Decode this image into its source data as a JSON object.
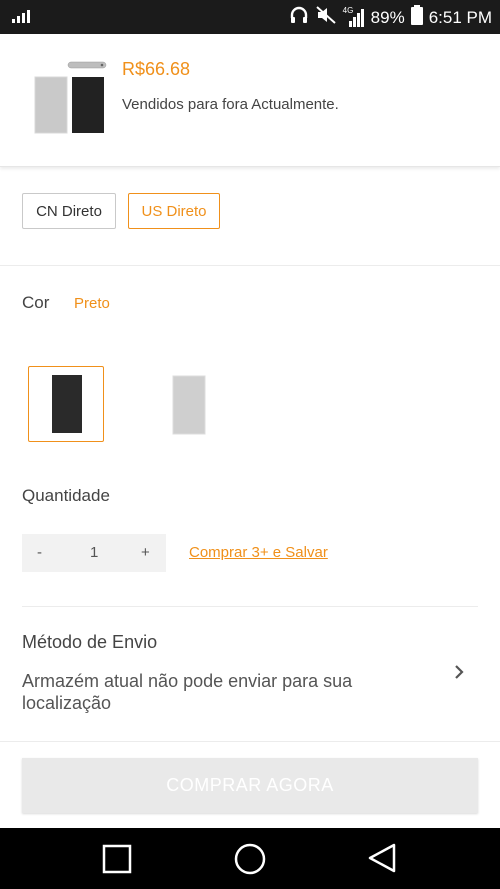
{
  "status_bar": {
    "network": "4G",
    "battery": "89%",
    "time": "6:51 PM"
  },
  "product": {
    "price": "R$66.68",
    "availability": "Vendidos para fora Actualmente."
  },
  "shipping_options": [
    {
      "label": "CN Direto",
      "selected": false
    },
    {
      "label": "US Direto",
      "selected": true
    }
  ],
  "color": {
    "label": "Cor",
    "selected_value": "Preto",
    "swatches": [
      "Preto",
      "Prata"
    ]
  },
  "quantity": {
    "label": "Quantidade",
    "minus": "-",
    "value": "1",
    "plus": "+",
    "deal_link": "Comprar 3+ e Salvar"
  },
  "shipping_method": {
    "title": "Método de Envio",
    "message": "Armazém atual não pode enviar para sua localização"
  },
  "buy_button": "COMPRAR AGORA",
  "colors": {
    "accent": "#f0901a",
    "status_bar": "#1b1b1b",
    "nav_bar": "#000000"
  }
}
